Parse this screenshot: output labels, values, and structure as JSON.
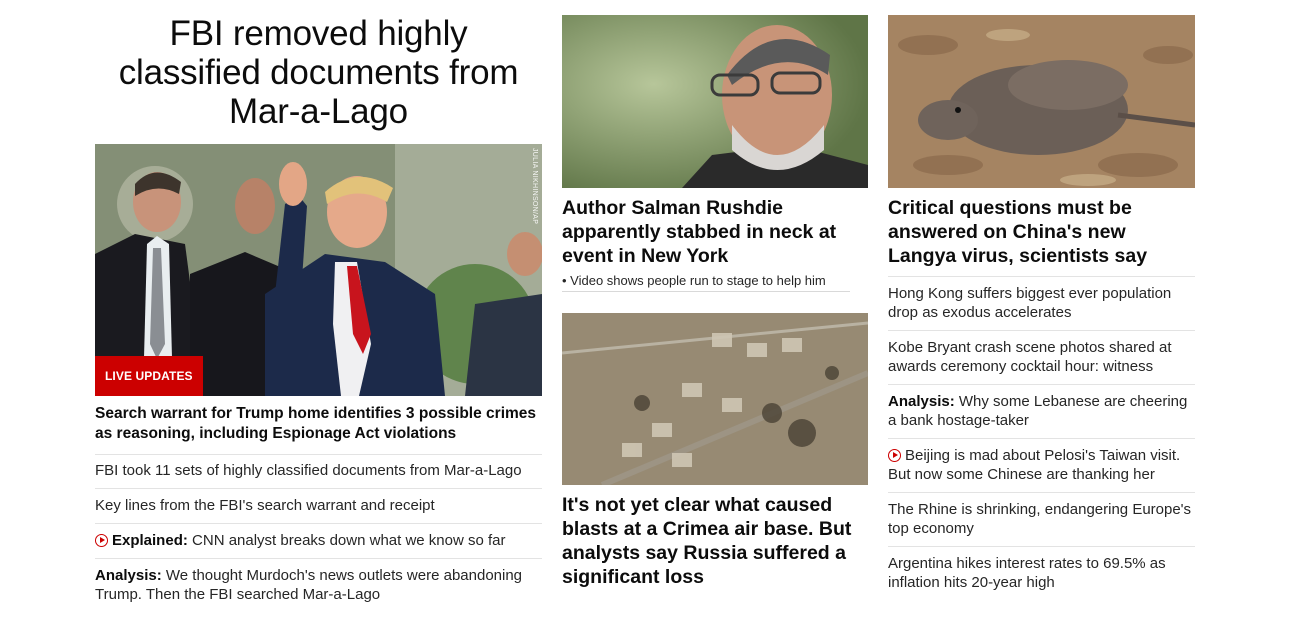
{
  "left": {
    "hero_title": "FBI removed highly classified documents from Mar-a-Lago",
    "image_credit": "JULIA NIKHINSON/AP",
    "badge": "LIVE UPDATES",
    "lead_headline": "Search warrant for Trump home identifies 3 possible crimes as reasoning, including Espionage Act violations",
    "items": [
      {
        "prefix": "",
        "text": "FBI took 11 sets of highly classified documents from Mar-a-Lago"
      },
      {
        "prefix": "",
        "text": "Key lines from the FBI's search warrant and receipt"
      },
      {
        "prefix": "Explained:",
        "text": "CNN analyst breaks down what we know so far",
        "video": true
      },
      {
        "prefix": "Analysis:",
        "text": "We thought Murdoch's news outlets were abandoning Trump. Then the FBI searched Mar-a-Lago"
      }
    ]
  },
  "middle": {
    "story1": {
      "headline": "Author Salman Rushdie apparently stabbed in neck at event in New York",
      "related": "• Video shows people run to stage to help him"
    },
    "story2": {
      "headline": "It's not yet clear what caused blasts at a Crimea air base. But analysts say Russia suffered a significant loss"
    }
  },
  "right": {
    "story1": {
      "headline": "Critical questions must be answered on China's new Langya virus, scientists say"
    },
    "items": [
      {
        "prefix": "",
        "text": "Hong Kong suffers biggest ever population drop as exodus accelerates"
      },
      {
        "prefix": "",
        "text": "Kobe Bryant crash scene photos shared at awards ceremony cocktail hour: witness"
      },
      {
        "prefix": "Analysis:",
        "text": "Why some Lebanese are cheering a bank hostage-taker"
      },
      {
        "prefix": "",
        "text": "Beijing is mad about Pelosi's Taiwan visit. But now some Chinese are thanking her",
        "video": true
      },
      {
        "prefix": "",
        "text": "The Rhine is shrinking, endangering Europe's top economy"
      },
      {
        "prefix": "",
        "text": "Argentina hikes interest rates to 69.5% as inflation hits 20-year high"
      }
    ]
  },
  "colors": {
    "accent": "#cc0000",
    "text": "#0c0c0c",
    "divider": "#e3e3e3"
  }
}
